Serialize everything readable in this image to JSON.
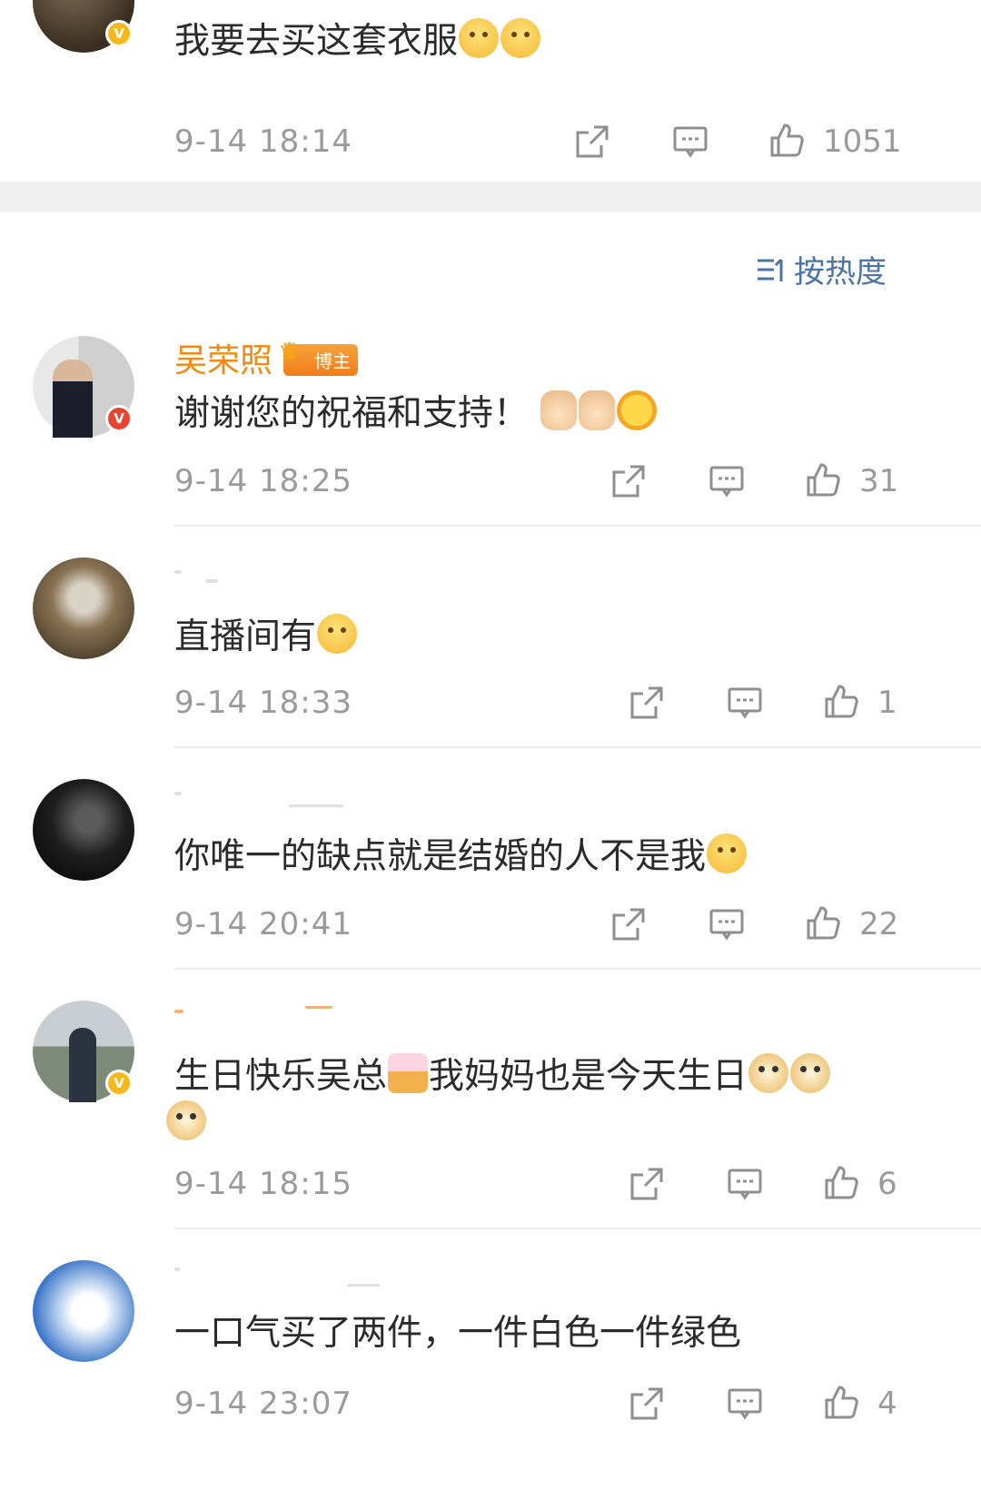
{
  "top_comment": {
    "text": "我要去买这套衣服",
    "emojis": [
      "laughing-face",
      "laughing-face"
    ],
    "time": "9-14 18:14",
    "likes": "1051"
  },
  "sort_label": "按热度",
  "comments": [
    {
      "name": "吴荣照",
      "tag": "博主",
      "text": "谢谢您的祝福和支持！",
      "emojis": [
        "prayer-hands",
        "prayer-hands",
        "sun-face"
      ],
      "time": "9-14 18:25",
      "likes": "31",
      "badge": "red"
    },
    {
      "name": "",
      "text": "直播间有",
      "emojis": [
        "grin-face"
      ],
      "time": "9-14 18:33",
      "likes": "1"
    },
    {
      "name": "",
      "text": "你唯一的缺点就是结婚的人不是我",
      "emojis": [
        "crying-face"
      ],
      "time": "9-14 20:41",
      "likes": "22"
    },
    {
      "name": "",
      "text": "生日快乐吴总",
      "text_middle": "我妈妈也是今天生日",
      "emojis": [
        "cake",
        "doge",
        "doge",
        "doge"
      ],
      "time": "9-14 18:15",
      "likes": "6",
      "badge": "gold"
    },
    {
      "name": "",
      "text": "一口气买了两件，一件白色一件绿色",
      "emojis": [],
      "time": "9-14 23:07",
      "likes": "4"
    }
  ],
  "icons": {
    "share": "share-icon",
    "comment": "comment-icon",
    "like": "thumbs-up-icon",
    "sort": "sort-icon",
    "verified": "verified-badge-icon"
  },
  "colors": {
    "name": "#f08a12",
    "sort": "#4a74a5",
    "meta": "#9a9a9a",
    "text": "#2b2b2b",
    "separator_band": "#efefef"
  }
}
